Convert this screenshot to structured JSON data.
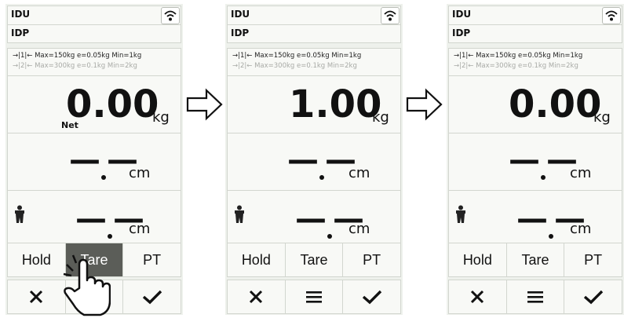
{
  "panels": [
    {
      "header1": "IDU",
      "header2": "IDP",
      "info_line1": "→|1|← Max=150kg e=0.05kg Min=1kg",
      "info_line2": "→|2|← Max=300kg e=0.1kg Min=2kg",
      "weight_value": "0.00",
      "weight_unit": "kg",
      "net_label": "Net",
      "dim1_unit": "cm",
      "dim2_unit": "cm",
      "buttons": {
        "hold": "Hold",
        "tare": "Tare",
        "pt": "PT"
      },
      "tare_pressed": true
    },
    {
      "header1": "IDU",
      "header2": "IDP",
      "info_line1": "→|1|← Max=150kg e=0.05kg Min=1kg",
      "info_line2": "→|2|← Max=300kg e=0.1kg Min=2kg",
      "weight_value": "1.00",
      "weight_unit": "kg",
      "dim1_unit": "cm",
      "dim2_unit": "cm",
      "buttons": {
        "hold": "Hold",
        "tare": "Tare",
        "pt": "PT"
      },
      "tare_pressed": false
    },
    {
      "header1": "IDU",
      "header2": "IDP",
      "info_line1": "→|1|← Max=150kg e=0.05kg Min=1kg",
      "info_line2": "→|2|← Max=300kg e=0.1kg Min=2kg",
      "weight_value": "0.00",
      "weight_unit": "kg",
      "dim1_unit": "cm",
      "dim2_unit": "cm",
      "buttons": {
        "hold": "Hold",
        "tare": "Tare",
        "pt": "PT"
      },
      "tare_pressed": false
    }
  ],
  "icons": {
    "wifi": "wifi-icon",
    "person": "person-icon",
    "cancel": "close-icon",
    "menu": "menu-icon",
    "confirm": "check-icon",
    "flow_arrow": "arrow-right-icon",
    "pointer": "hand-pointer-icon"
  },
  "colors": {
    "panel_bg": "#eef1ec",
    "cell_bg": "#f8f9f6",
    "border": "#d2d6cf",
    "pressed_button": "#5b5d58",
    "info_disabled": "#a8aaa6"
  }
}
